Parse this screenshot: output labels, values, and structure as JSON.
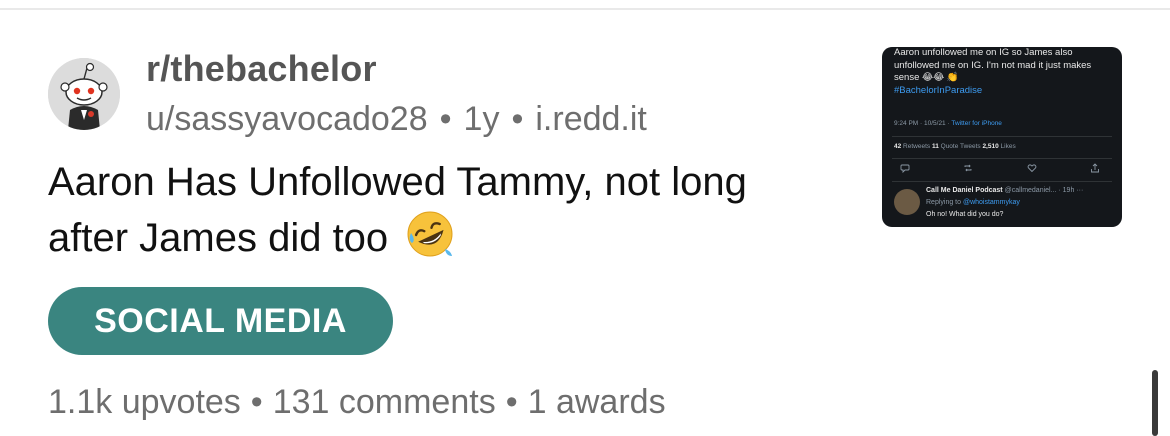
{
  "post": {
    "subreddit": "r/thebachelor",
    "author": "u/sassyavocado28",
    "age": "1y",
    "domain": "i.redd.it",
    "separator": "•",
    "title": "Aaron Has Unfollowed Tammy, not long after James did too",
    "title_emoji": "rolling-on-floor-laughing-emoji",
    "flair": "SOCIAL MEDIA",
    "flair_color": "#3a8580",
    "stats": {
      "upvotes": "1.1k upvotes",
      "comments": "131 comments",
      "awards": "1 awards"
    }
  },
  "thumbnail": {
    "tweet_text": "Aaron unfollowed me on IG so James also unfollowed me on IG. I'm not mad it just makes sense 😂😂 👏",
    "hashtag": "#BachelorInParadise",
    "time": "9:24 PM · 10/5/21 · ",
    "client": "Twitter for iPhone",
    "retweets_count": "42",
    "retweets_label": " Retweets  ",
    "quotes_count": "11",
    "quotes_label": " Quote Tweets  ",
    "likes_count": "2,510",
    "likes_label": " Likes",
    "reply_name": "Call Me Daniel Podcast",
    "reply_handle": " @callmedaniel... · 19h  ···",
    "reply_to_label": "Replying to ",
    "reply_to_handle": "@whoistammykay",
    "reply_text": "Oh no! What did you do?"
  }
}
